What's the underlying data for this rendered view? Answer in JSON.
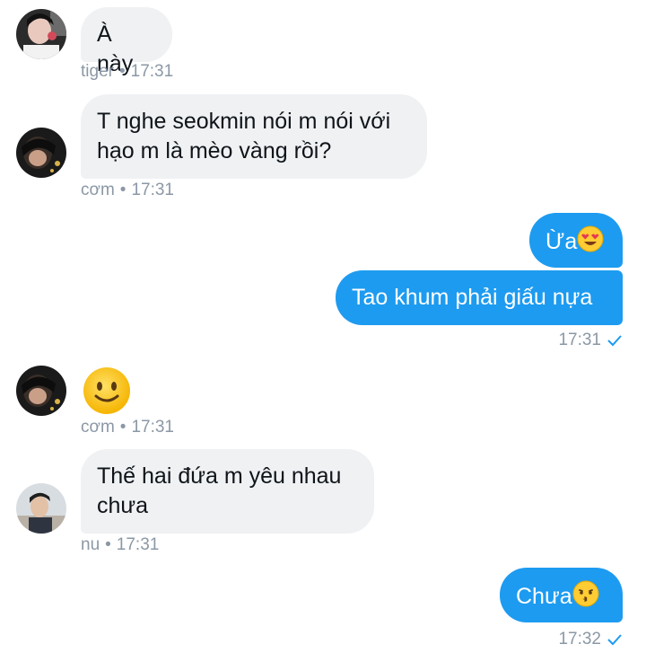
{
  "messages": [
    {
      "sender": "tiger",
      "text": "À này",
      "time": "17:31"
    },
    {
      "sender": "cơm",
      "text": "T nghe seokmin nói m nói với hạo m là mèo vàng rồi?",
      "time": "17:31"
    },
    {
      "sender": "me",
      "text": "Ừa",
      "emoji": "smiling-face-with-heart-eyes-icon"
    },
    {
      "sender": "me",
      "text": "Tao khum phải giấu nựa",
      "time": "17:31",
      "status": "sent"
    },
    {
      "sender": "cơm",
      "emoji": "slightly-smiling-face-icon",
      "time": "17:31"
    },
    {
      "sender": "nu",
      "text": "Thế hai đứa m yêu nhau chưa",
      "time": "17:31"
    },
    {
      "sender": "me",
      "text": "Chưa",
      "emoji": "kissing-face-icon",
      "time": "17:32",
      "status": "sent"
    }
  ],
  "separator": "•",
  "colors": {
    "outgoing": "#1d9bf0",
    "incoming": "#eff1f3",
    "meta": "#8b98a5"
  }
}
